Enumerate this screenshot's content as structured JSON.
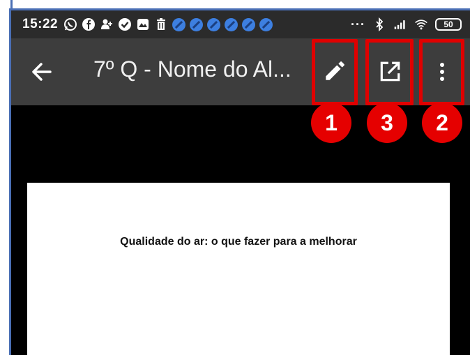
{
  "status_bar": {
    "time": "15:22",
    "battery_level": "50",
    "overflow": "···",
    "icons": [
      "whatsapp-icon",
      "facebook-icon",
      "user-add-icon",
      "check-circle-icon",
      "gallery-icon",
      "trash-icon",
      "blocked-icon",
      "blocked-icon",
      "blocked-icon",
      "blocked-icon",
      "blocked-icon",
      "blocked-icon"
    ]
  },
  "toolbar": {
    "title": "7º Q - Nome do Al...",
    "actions": [
      "edit-icon",
      "open-external-icon",
      "more-vert-icon"
    ]
  },
  "annotations": {
    "badge_edit": "1",
    "badge_open": "3",
    "badge_menu": "2",
    "highlight_color": "#e00000"
  },
  "document": {
    "heading": "Qualidade do ar: o que fazer para a melhorar"
  }
}
